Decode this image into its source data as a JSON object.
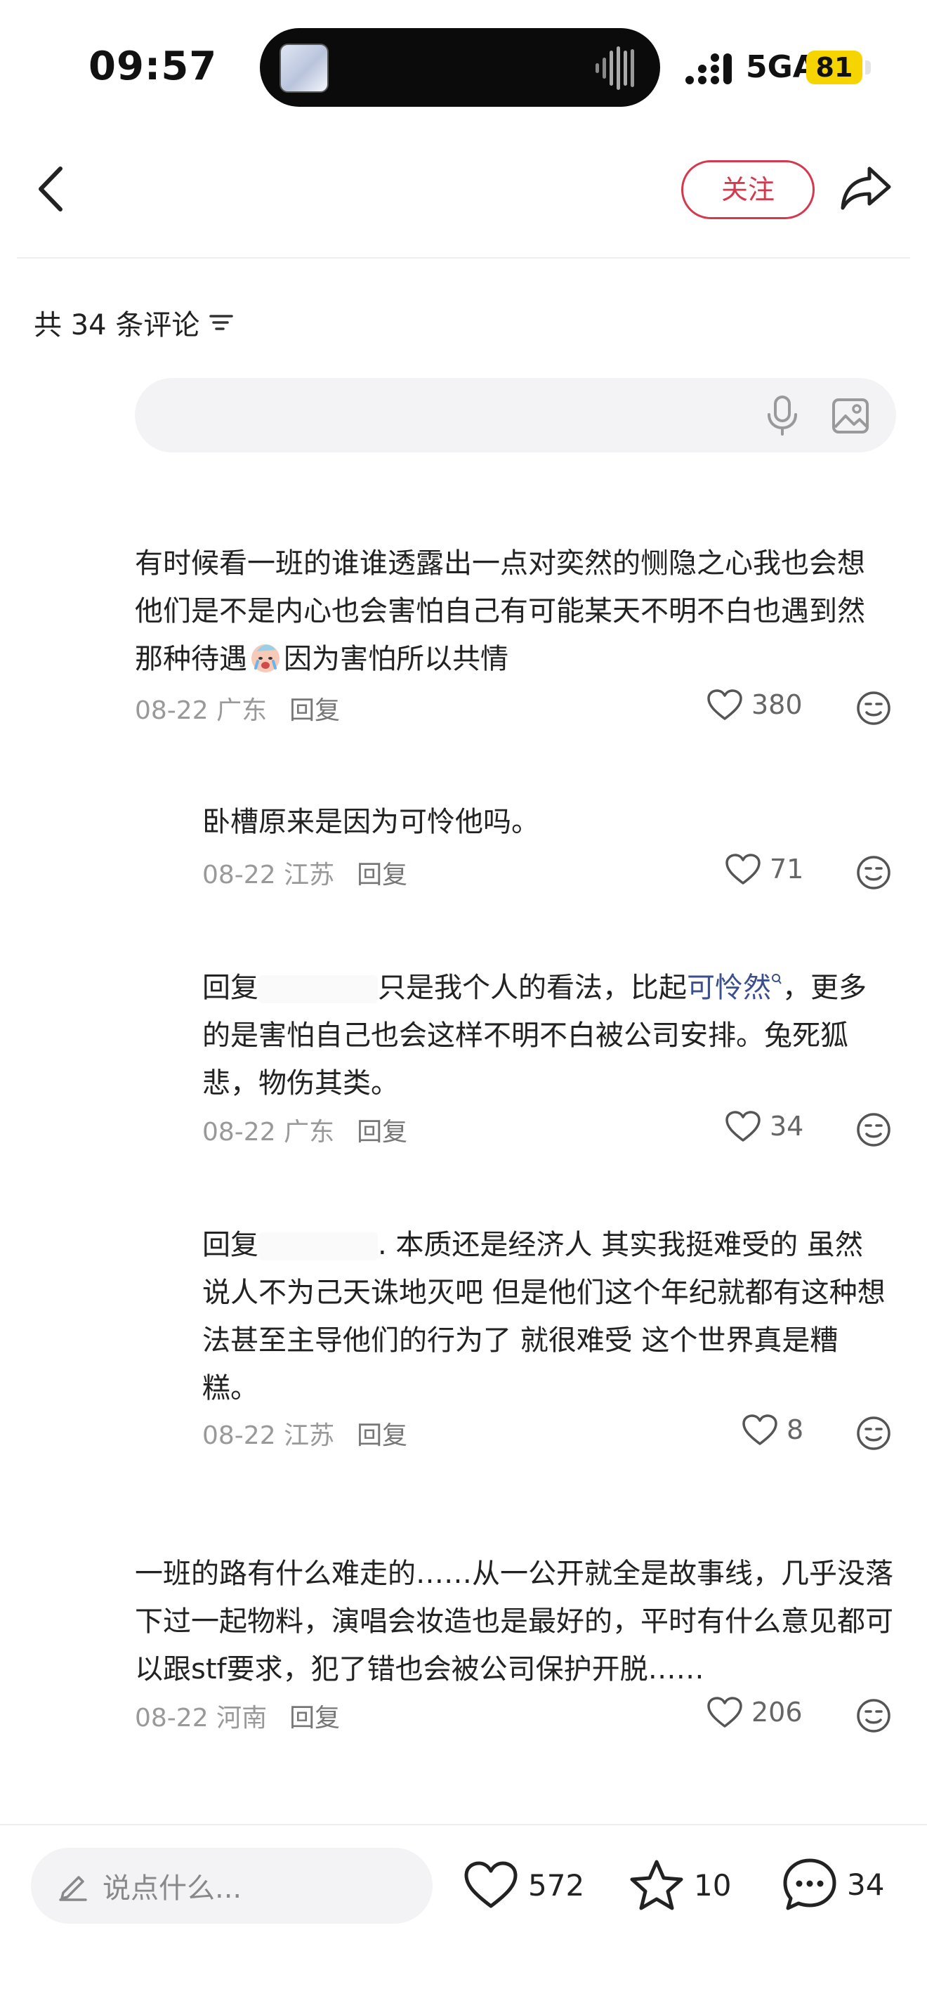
{
  "status_bar": {
    "time": "09:57",
    "network": "5GA",
    "battery": "81"
  },
  "header": {
    "follow_label": "关注"
  },
  "comments_header": {
    "count_label": "共 34 条评论"
  },
  "input": {
    "placeholder": ""
  },
  "comments": [
    {
      "text_part1": "有时候看一班的谁谁透露出一点对奕然的恻隐之心我也会想他们是不是内心也会害怕自己有可能某天不明不白也遇到然那种待遇",
      "text_part2": "因为害怕所以共情",
      "date": "08-22",
      "region": "广东",
      "reply_label": "回复",
      "likes": "380"
    },
    {
      "text": "卧槽原来是因为可怜他吗。",
      "date": "08-22",
      "region": "江苏",
      "reply_label": "回复",
      "likes": "71"
    },
    {
      "prefix": "回复",
      "text_part1": "只是我个人的看法，比起",
      "mention": "可怜然",
      "text_part2": "，更多的是害怕自己也会这样不明不白被公司安排。兔死狐悲，物伤其类。",
      "date": "08-22",
      "region": "广东",
      "reply_label": "回复",
      "likes": "34"
    },
    {
      "prefix": "回复",
      "text": ". 本质还是经济人 其实我挺难受的 虽然说人不为己天诛地灭吧 但是他们这个年纪就都有这种想法甚至主导他们的行为了 就很难受 这个世界真是糟糕。",
      "date": "08-22",
      "region": "江苏",
      "reply_label": "回复",
      "likes": "8"
    },
    {
      "text": "一班的路有什么难走的……从一公开就全是故事线，几乎没落下过一起物料，演唱会妆造也是最好的，平时有什么意见都可以跟stf要求，犯了错也会被公司保护开脱……",
      "date": "08-22",
      "region": "河南",
      "reply_label": "回复",
      "likes": "206"
    }
  ],
  "bottom_bar": {
    "say_placeholder": "说点什么...",
    "likes": "572",
    "favorites": "10",
    "comments": "34"
  },
  "colors": {
    "accent": "#d43a4e",
    "mention": "#3b4f8c",
    "battery": "#f5d400"
  },
  "icons": [
    "back-icon",
    "share-icon",
    "sort-icon",
    "mic-icon",
    "image-icon",
    "heart-icon",
    "emoji-icon",
    "pencil-icon",
    "star-icon",
    "comment-bubble-icon"
  ]
}
